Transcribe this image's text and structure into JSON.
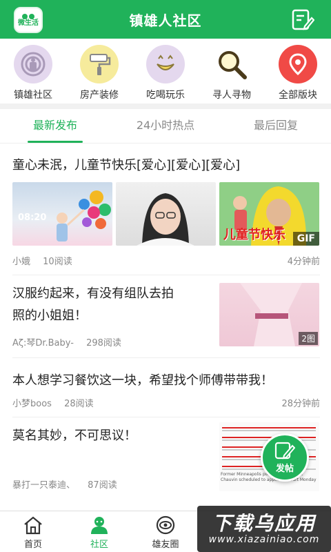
{
  "header": {
    "logo_text": "微生活",
    "title": "镇雄人社区"
  },
  "categories": [
    {
      "label": "镇雄社区",
      "icon": "broadcast-icon",
      "bg": "#e4d8ee"
    },
    {
      "label": "房产装修",
      "icon": "paint-roller-icon",
      "bg": "#f6eb9c"
    },
    {
      "label": "吃喝玩乐",
      "icon": "smiling-lips-icon",
      "bg": "#e4d8ee"
    },
    {
      "label": "寻人寻物",
      "icon": "magnifier-icon",
      "bg": "#ffffff"
    },
    {
      "label": "全部版块",
      "icon": "location-pin-icon",
      "bg": "#f04a46"
    }
  ],
  "tabs": [
    "最新发布",
    "24小时热点",
    "最后回复"
  ],
  "posts": [
    {
      "title": "童心未泯，儿童节快乐[爱心][爱心][爱心]",
      "author": "小娥",
      "reads": "10阅读",
      "time": "4分钟前",
      "thumb_text_1": "08:20",
      "thumb_text_3": "儿童节快乐",
      "gif_label": "GIF"
    },
    {
      "title_line1": "汉服约起来，有没有组队去拍",
      "title_line2": "照的小姐姐！",
      "author": "Aζ:琴Dr.Baby-",
      "reads": "298阅读",
      "img_count": "2图"
    },
    {
      "title": "本人想学习餐饮这一块，希望找个师傅带带我！",
      "author": "小梦boos",
      "reads": "28阅读",
      "time": "28分钟前"
    },
    {
      "title": "莫名其妙，不可思议！",
      "author": "暴打一只泰迪、",
      "reads": "87阅读",
      "caption": "Former Minneapolis police officer Derek Chauvin scheduled to appear in court Monday"
    }
  ],
  "fab_label": "发帖",
  "bottom_nav": [
    {
      "label": "首页",
      "icon": "home-icon"
    },
    {
      "label": "社区",
      "icon": "community-icon"
    },
    {
      "label": "雄友圈",
      "icon": "eye-circle-icon"
    }
  ],
  "watermark": {
    "main": "下载乌应用",
    "sub": "www.xiazainiao.com"
  },
  "colors": {
    "brand": "#20b25a",
    "text": "#222222",
    "meta": "#888888"
  }
}
